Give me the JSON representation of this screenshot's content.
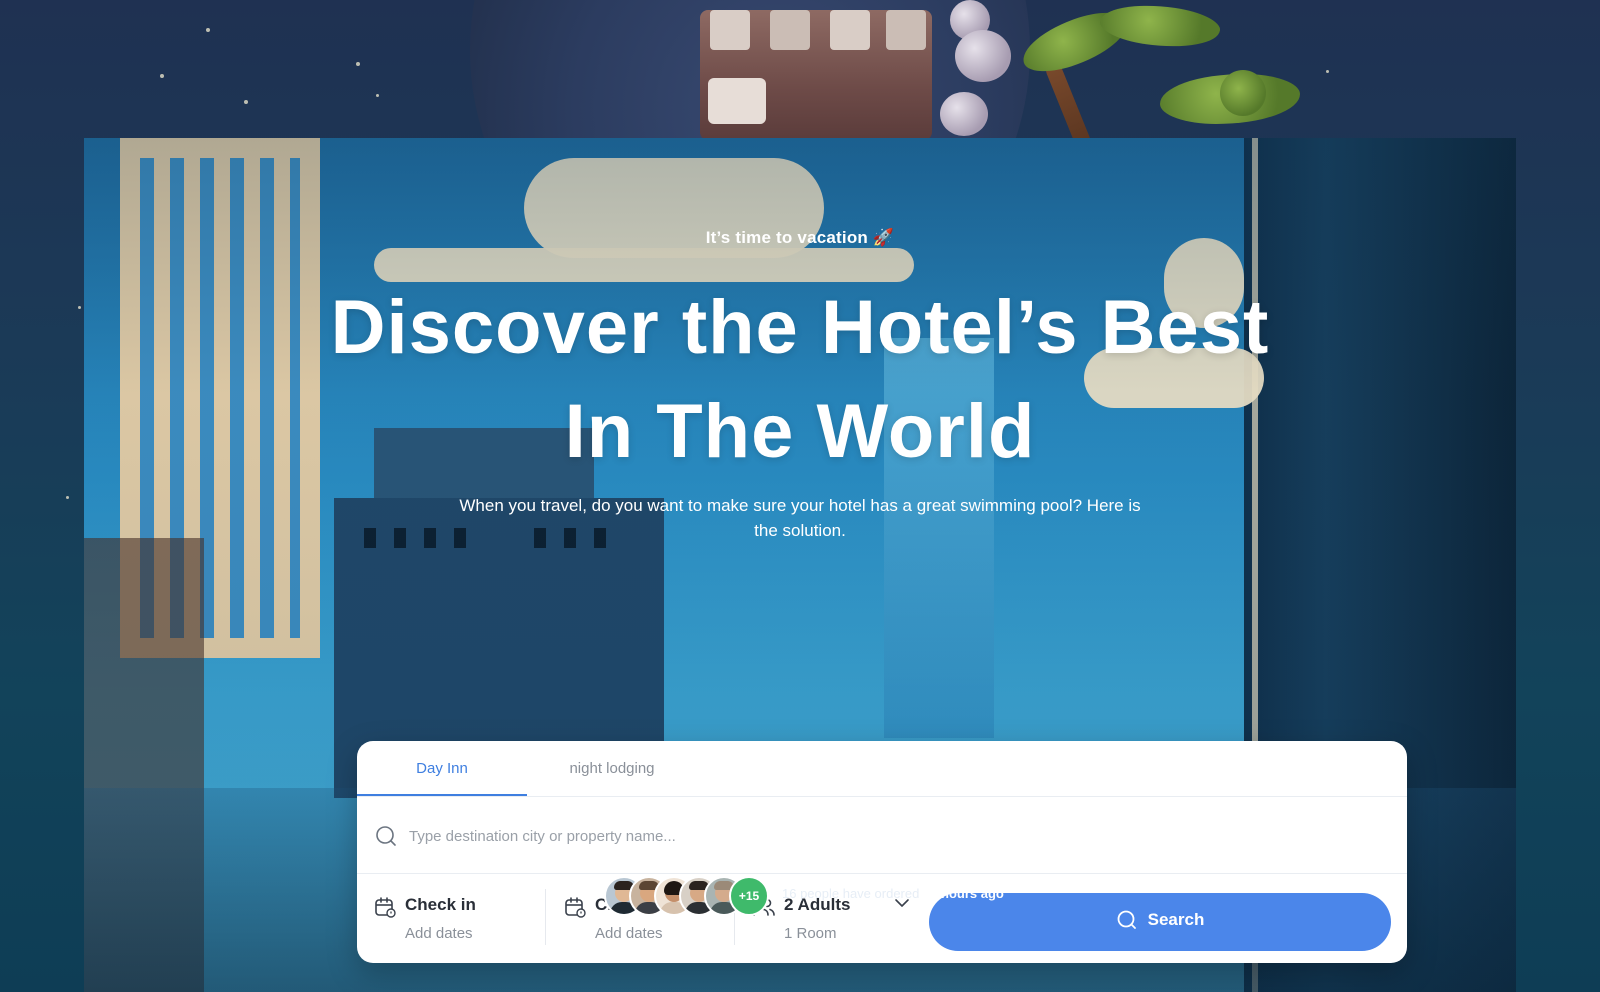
{
  "hero": {
    "kicker": "It’s time to vacation 🚀",
    "headline_line1": "Discover the Hotel’s Best",
    "headline_line2": "In The World",
    "subtext": "When you travel, do you want to make sure your hotel has a great swimming pool? Here is the solution."
  },
  "tabs": [
    {
      "label": "Day Inn",
      "active": true
    },
    {
      "label": "night lodging",
      "active": false
    }
  ],
  "search": {
    "placeholder": "Type destination city or property name...",
    "value": ""
  },
  "fields": {
    "check_in": {
      "title": "Check in",
      "subtitle": "Add dates",
      "icon": "calendar-icon"
    },
    "check_out": {
      "title": "Check out",
      "subtitle": "Add dates",
      "icon": "calendar-icon"
    },
    "guests": {
      "title": "2 Adults",
      "subtitle": "1 Room",
      "icon": "users-icon"
    }
  },
  "search_button": {
    "label": "Search",
    "icon": "search-icon"
  },
  "social_proof": {
    "extra_count": "+15",
    "text_prefix": "16 people have ordered",
    "text_emphasis": "24 hours ago"
  },
  "colors": {
    "accent": "#4b86ea",
    "active_tab": "#3f7fe0",
    "count_badge": "#3fba6b",
    "page_bg": "#1b3a57"
  }
}
